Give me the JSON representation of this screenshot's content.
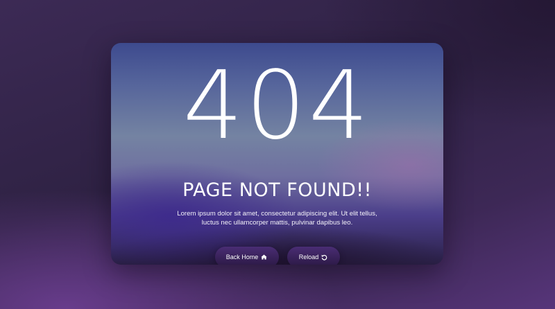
{
  "error": {
    "code": "404",
    "headline": "PAGE NOT FOUND!!",
    "description": "Lorem ipsum dolor sit amet, consectetur adipiscing elit. Ut elit tellus, luctus nec ullamcorper mattis, pulvinar dapibus leo."
  },
  "actions": {
    "home_label": "Back Home",
    "home_icon": "home-icon",
    "reload_label": "Reload",
    "reload_icon": "reload-icon"
  },
  "colors": {
    "background": "#33244a",
    "accent": "#5a3a86",
    "text": "#ffffff"
  }
}
